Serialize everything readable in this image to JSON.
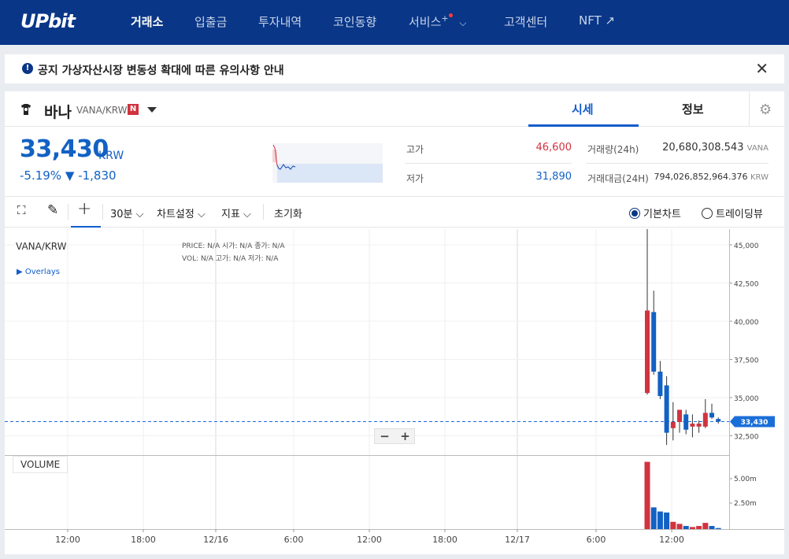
{
  "header": {
    "logo": "UPbit",
    "nav": [
      "거래소",
      "입출금",
      "투자내역",
      "코인동향",
      "서비스",
      "고객센터",
      "NFT ↗"
    ],
    "service_plus": "+",
    "service_chevron": "⌵"
  },
  "notice": {
    "icon": "!",
    "text": "공지  가상자산시장 변동성 확대에 따른 유의사항 안내",
    "close": "✕"
  },
  "coin": {
    "name": "바나",
    "pair": "VANA/KRW",
    "badge": "N",
    "tabs": [
      "시세",
      "정보"
    ],
    "gear": "⚙"
  },
  "price": {
    "current": "33,430",
    "unit": "KRW",
    "change_pct": "-5.19%",
    "change_arrow": "▼",
    "change_amt": "-1,830"
  },
  "stats": {
    "high_label": "고가",
    "high_value": "46,600",
    "low_label": "저가",
    "low_value": "31,890",
    "vol_label": "거래량(24h)",
    "vol_value": "20,680,308.543",
    "vol_unit": "VANA",
    "amt_label": "거래대금(24H)",
    "amt_value": "794,026,852,964.376",
    "amt_unit": "KRW"
  },
  "toolbar": {
    "fullscreen": "⛶",
    "pen": "✎",
    "crosshair": "+",
    "interval": "30분 ⌵",
    "chart_settings": "차트설정 ⌵",
    "indicators": "지표 ⌵",
    "reset": "초기화",
    "basic_chart": "기본차트",
    "trading_view": "트레이딩뷰"
  },
  "chart": {
    "symbol": "VANA/KRW",
    "overlays": "▶  Overlays",
    "ohlc_row1": "PRICE:  N/A     시가:  N/A     종가:  N/A",
    "ohlc_row2": "VOL:     N/A     고가:  N/A     저가:  N/A",
    "current_tag": "33,430",
    "volume_label": "VOLUME",
    "zoom_minus": "−",
    "zoom_plus": "+"
  },
  "chart_data": {
    "type": "candlestick",
    "symbol": "VANA/KRW",
    "interval": "30분",
    "y_axis_ticks": [
      "45,000",
      "42,500",
      "40,000",
      "37,500",
      "35,000",
      "32,500"
    ],
    "ylim": [
      31500,
      46600
    ],
    "current_price": 33430,
    "volume_axis_ticks": [
      "5.00m",
      "2.50m"
    ],
    "x_axis_ticks": [
      "12:00",
      "18:00",
      "12/16",
      "6:00",
      "12:00",
      "18:00",
      "12/17",
      "6:00",
      "12:00"
    ],
    "candles": [
      {
        "o": 40700,
        "h": 46600,
        "l": 35200,
        "c": 35300,
        "dir": "down"
      },
      {
        "o": 40600,
        "h": 42000,
        "l": 36500,
        "c": 36700,
        "dir": "down"
      },
      {
        "o": 36700,
        "h": 37400,
        "l": 34900,
        "c": 35100,
        "dir": "down"
      },
      {
        "o": 35800,
        "h": 36400,
        "l": 31900,
        "c": 32700,
        "dir": "down"
      },
      {
        "o": 33000,
        "h": 34700,
        "l": 32200,
        "c": 33400,
        "dir": "up"
      },
      {
        "o": 33400,
        "h": 34200,
        "l": 32700,
        "c": 34200,
        "dir": "up"
      },
      {
        "o": 33900,
        "h": 34200,
        "l": 32600,
        "c": 32900,
        "dir": "down"
      },
      {
        "o": 33100,
        "h": 33900,
        "l": 32400,
        "c": 33300,
        "dir": "up"
      },
      {
        "o": 33100,
        "h": 33500,
        "l": 32700,
        "c": 33300,
        "dir": "up"
      },
      {
        "o": 33100,
        "h": 34900,
        "l": 33000,
        "c": 34000,
        "dir": "up"
      },
      {
        "o": 34000,
        "h": 34600,
        "l": 33600,
        "c": 33700,
        "dir": "down"
      },
      {
        "o": 33600,
        "h": 33700,
        "l": 33300,
        "c": 33430,
        "dir": "down"
      }
    ],
    "volume_m": [
      6.5,
      2.1,
      1.7,
      1.6,
      0.7,
      0.5,
      0.3,
      0.2,
      0.3,
      0.6,
      0.3,
      0.1
    ]
  }
}
